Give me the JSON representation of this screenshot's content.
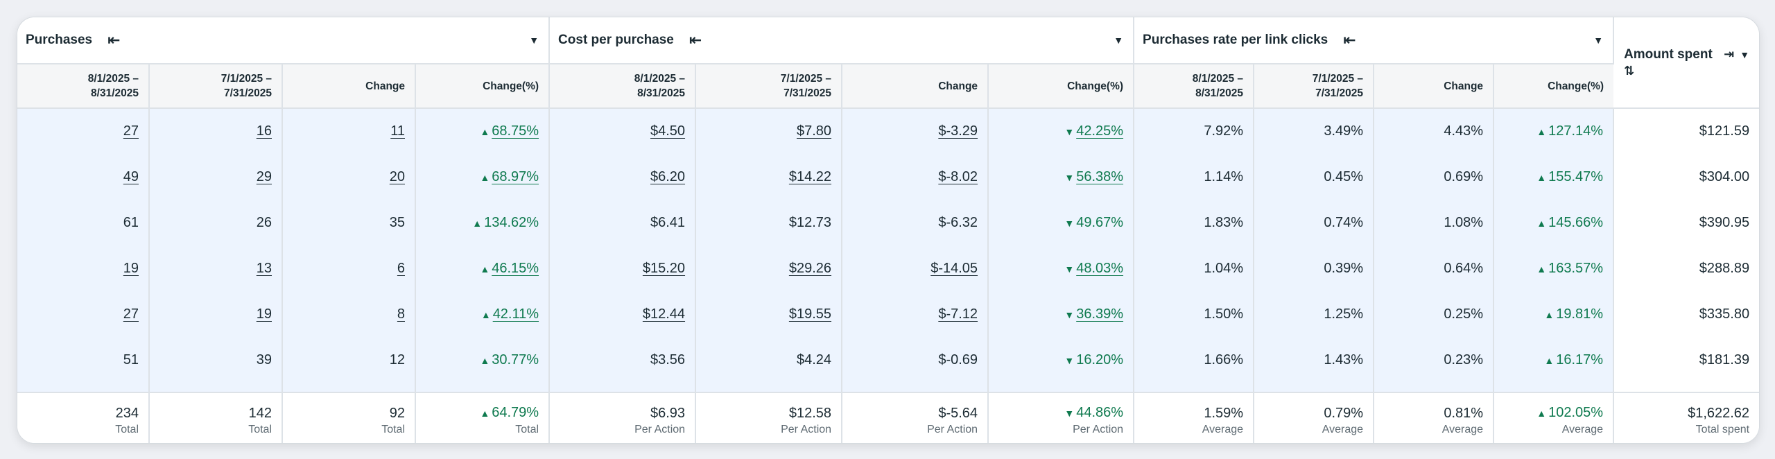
{
  "groups": {
    "purchases": "Purchases",
    "cost_per_purchase": "Cost per purchase",
    "purchase_rate": "Purchases rate per link clicks",
    "amount_spent": "Amount spent"
  },
  "icons": {
    "collapse": "⇤",
    "dropdown": "▼",
    "pin": "⇥",
    "sort": "⇅",
    "up": "▲",
    "down": "▼"
  },
  "subheaders": {
    "current_l1": "8/1/2025 –",
    "current_l2": "8/31/2025",
    "previous_l1": "7/1/2025 –",
    "previous_l2": "7/31/2025",
    "change": "Change",
    "change_pct": "Change(%)"
  },
  "rows": [
    {
      "p_cur": "27",
      "p_prev": "16",
      "p_chg": "11",
      "p_pct": "68.75%",
      "c_cur": "$4.50",
      "c_prev": "$7.80",
      "c_chg": "$-3.29",
      "c_pct": "42.25%",
      "r_cur": "7.92%",
      "r_prev": "3.49%",
      "r_chg": "4.43%",
      "r_pct": "127.14%",
      "amount": "$121.59"
    },
    {
      "p_cur": "49",
      "p_prev": "29",
      "p_chg": "20",
      "p_pct": "68.97%",
      "c_cur": "$6.20",
      "c_prev": "$14.22",
      "c_chg": "$-8.02",
      "c_pct": "56.38%",
      "r_cur": "1.14%",
      "r_prev": "0.45%",
      "r_chg": "0.69%",
      "r_pct": "155.47%",
      "amount": "$304.00"
    },
    {
      "p_cur": "61",
      "p_prev": "26",
      "p_chg": "35",
      "p_pct": "134.62%",
      "c_cur": "$6.41",
      "c_prev": "$12.73",
      "c_chg": "$-6.32",
      "c_pct": "49.67%",
      "r_cur": "1.83%",
      "r_prev": "0.74%",
      "r_chg": "1.08%",
      "r_pct": "145.66%",
      "amount": "$390.95"
    },
    {
      "p_cur": "19",
      "p_prev": "13",
      "p_chg": "6",
      "p_pct": "46.15%",
      "c_cur": "$15.20",
      "c_prev": "$29.26",
      "c_chg": "$-14.05",
      "c_pct": "48.03%",
      "r_cur": "1.04%",
      "r_prev": "0.39%",
      "r_chg": "0.64%",
      "r_pct": "163.57%",
      "amount": "$288.89"
    },
    {
      "p_cur": "27",
      "p_prev": "19",
      "p_chg": "8",
      "p_pct": "42.11%",
      "c_cur": "$12.44",
      "c_prev": "$19.55",
      "c_chg": "$-7.12",
      "c_pct": "36.39%",
      "r_cur": "1.50%",
      "r_prev": "1.25%",
      "r_chg": "0.25%",
      "r_pct": "19.81%",
      "amount": "$335.80"
    },
    {
      "p_cur": "51",
      "p_prev": "39",
      "p_chg": "12",
      "p_pct": "30.77%",
      "c_cur": "$3.56",
      "c_prev": "$4.24",
      "c_chg": "$-0.69",
      "c_pct": "16.20%",
      "r_cur": "1.66%",
      "r_prev": "1.43%",
      "r_chg": "0.23%",
      "r_pct": "16.17%",
      "amount": "$181.39"
    }
  ],
  "totals": {
    "p_cur": "234",
    "p_prev": "142",
    "p_chg": "92",
    "p_pct": "64.79%",
    "c_cur": "$6.93",
    "c_prev": "$12.58",
    "c_chg": "$-5.64",
    "c_pct": "44.86%",
    "r_cur": "1.59%",
    "r_prev": "0.79%",
    "r_chg": "0.81%",
    "r_pct": "102.05%",
    "amount": "$1,622.62"
  },
  "total_labels": {
    "total": "Total",
    "per_action": "Per Action",
    "average": "Average",
    "total_spent": "Total spent"
  },
  "colors": {
    "positive": "#0f7a4f",
    "row_bg": "#edf4fe",
    "header_bg": "#f5f6f7"
  }
}
